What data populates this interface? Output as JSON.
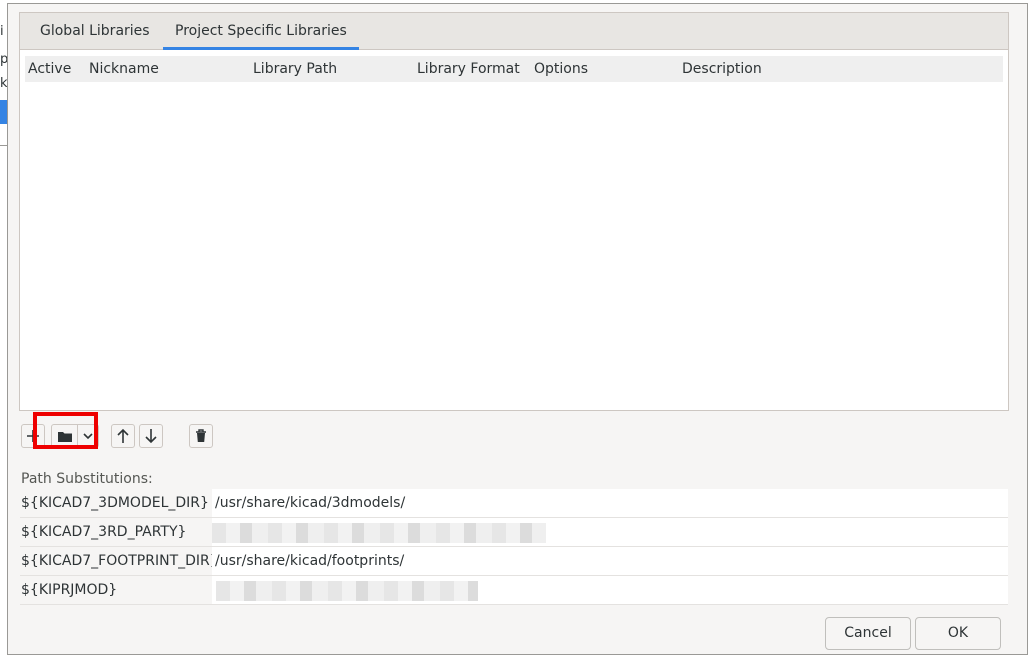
{
  "tabs": [
    {
      "label": "Global Libraries",
      "active": false
    },
    {
      "label": "Project Specific Libraries",
      "active": true
    }
  ],
  "grid": {
    "columns": [
      "Active",
      "Nickname",
      "Library Path",
      "Library Format",
      "Options",
      "Description"
    ]
  },
  "toolbar": {
    "add_icon": "plus-icon",
    "browse_icon": "folder-icon",
    "menu_icon": "chevron-down-icon",
    "up_icon": "arrow-up-icon",
    "down_icon": "arrow-down-icon",
    "delete_icon": "trash-icon"
  },
  "path_substitutions": {
    "label": "Path Substitutions:",
    "rows": [
      {
        "name": "${KICAD7_3DMODEL_DIR}",
        "value": "/usr/share/kicad/3dmodels/"
      },
      {
        "name": "${KICAD7_3RD_PARTY}",
        "value": ""
      },
      {
        "name": "${KICAD7_FOOTPRINT_DIR}",
        "value": "/usr/share/kicad/footprints/"
      },
      {
        "name": "${KIPRJMOD}",
        "value": ""
      }
    ]
  },
  "buttons": {
    "cancel": "Cancel",
    "ok": "OK"
  },
  "colors": {
    "accent": "#3584e4",
    "highlight": "#ee0000"
  }
}
